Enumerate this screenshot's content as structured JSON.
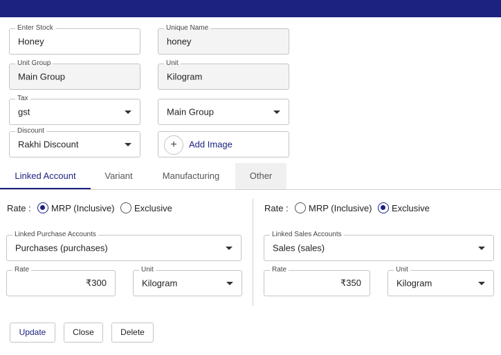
{
  "form": {
    "stock": {
      "label": "Enter Stock",
      "value": "Honey"
    },
    "unique_name": {
      "label": "Unique Name",
      "value": "honey"
    },
    "unit_group": {
      "label": "Unit Group",
      "value": "Main Group"
    },
    "unit": {
      "label": "Unit",
      "value": "Kilogram"
    },
    "tax": {
      "label": "Tax",
      "value": "gst"
    },
    "group": {
      "value": "Main Group"
    },
    "discount": {
      "label": "Discount",
      "value": "Rakhi Discount"
    },
    "add_image": {
      "plus": "+",
      "label": "Add Image"
    }
  },
  "tabs": [
    {
      "label": "Linked Account",
      "active": true
    },
    {
      "label": "Variant"
    },
    {
      "label": "Manufacturing"
    },
    {
      "label": "Other"
    }
  ],
  "purchase": {
    "rate_label": "Rate :",
    "options": [
      "MRP (Inclusive)",
      "Exclusive"
    ],
    "selected": "MRP (Inclusive)",
    "account": {
      "label": "Linked Purchase Accounts",
      "value": "Purchases (purchases)"
    },
    "rate": {
      "label": "Rate",
      "value": "₹300"
    },
    "unit": {
      "label": "Unit",
      "value": "Kilogram"
    }
  },
  "sales": {
    "rate_label": "Rate :",
    "options": [
      "MRP (Inclusive)",
      "Exclusive"
    ],
    "selected": "Exclusive",
    "account": {
      "label": "Linked Sales Accounts",
      "value": "Sales (sales)"
    },
    "rate": {
      "label": "Rate",
      "value": "₹350"
    },
    "unit": {
      "label": "Unit",
      "value": "Kilogram"
    }
  },
  "buttons": {
    "update": "Update",
    "close": "Close",
    "delete": "Delete"
  },
  "colors": {
    "header": "#1c2280",
    "accent": "#1c2280"
  }
}
